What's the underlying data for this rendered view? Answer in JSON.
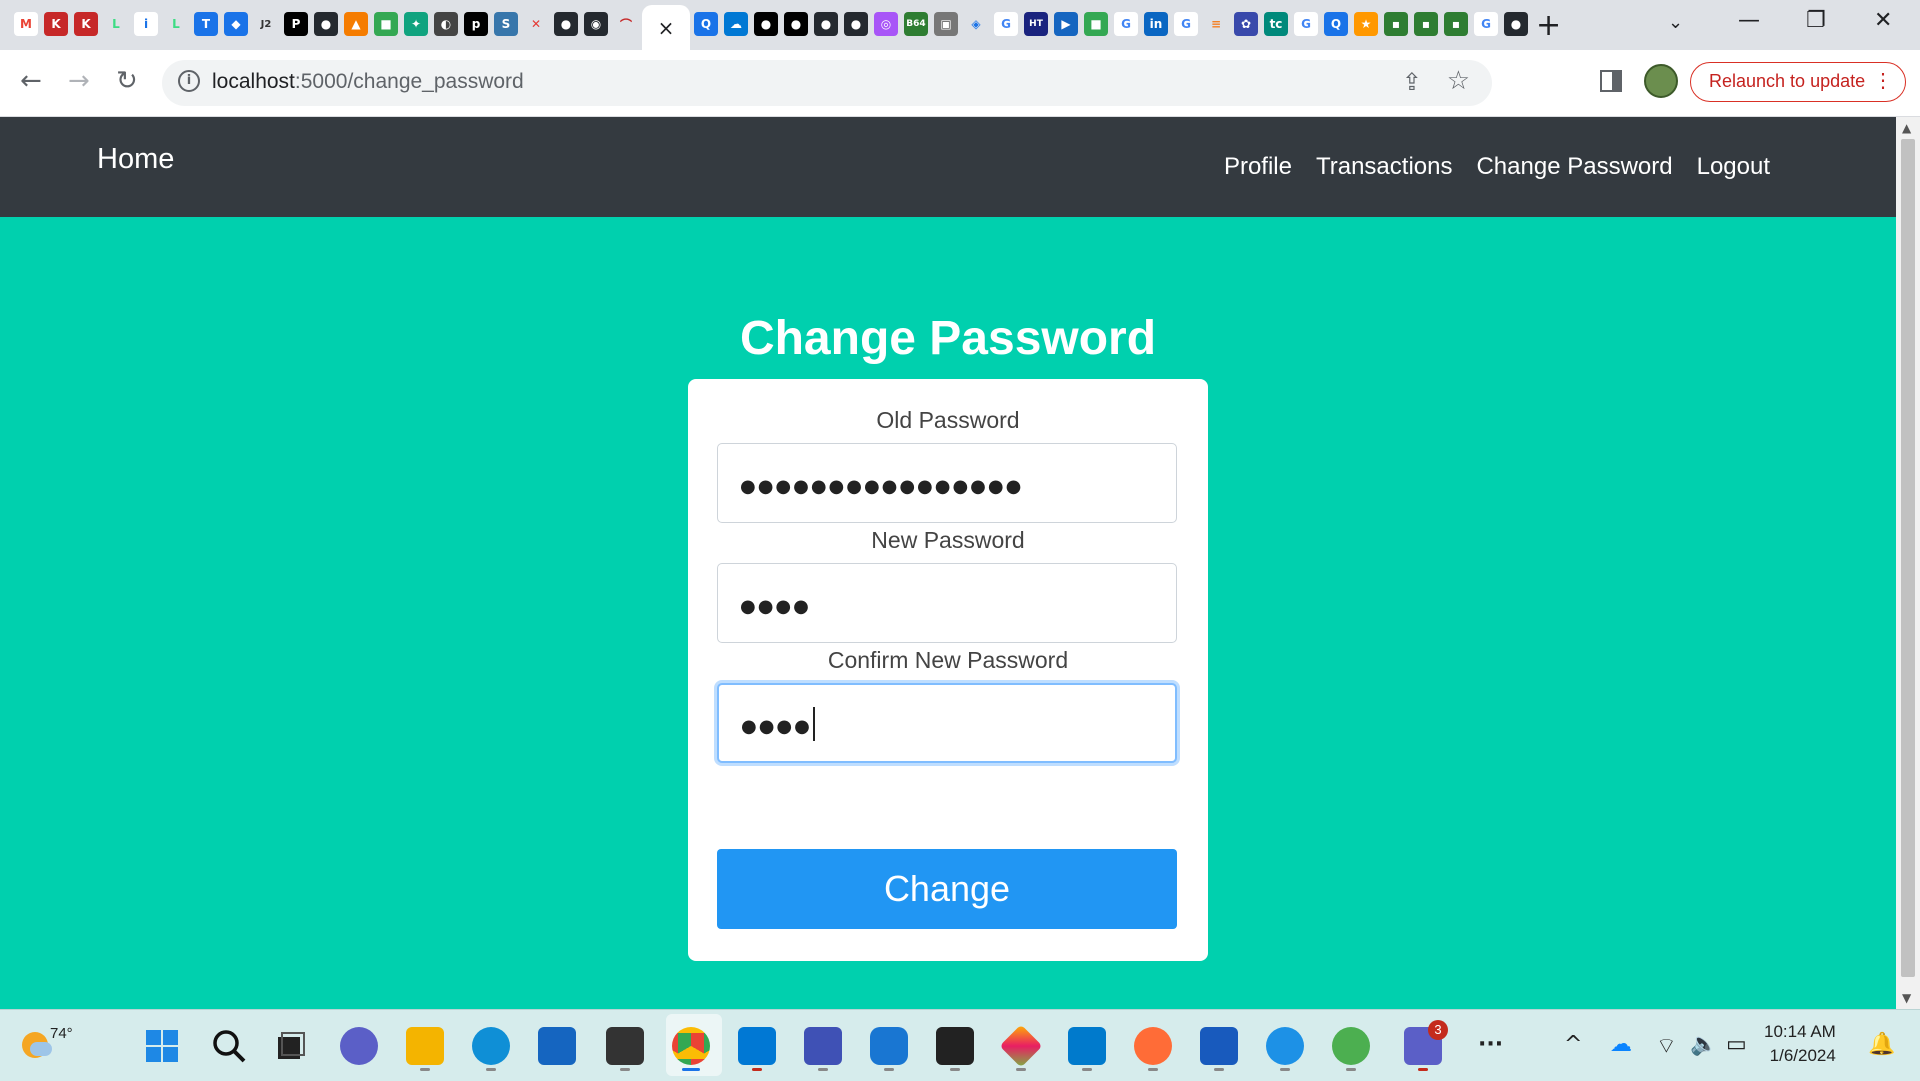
{
  "browser": {
    "url": "localhost:5000/change_password",
    "url_host": "localhost",
    "url_rest": ":5000/change_password",
    "relaunch_label": "Relaunch to update",
    "new_tab_symbol": "+",
    "close_tab_symbol": "×"
  },
  "navbar": {
    "brand": "Home",
    "links": [
      "Profile",
      "Transactions",
      "Change Password",
      "Logout"
    ]
  },
  "form": {
    "title": "Change Password",
    "fields": [
      {
        "label": "Old Password",
        "value": "●●●●●●●●●●●●●●●●"
      },
      {
        "label": "New Password",
        "value": "●●●●"
      },
      {
        "label": "Confirm New Password",
        "value": "●●●●"
      }
    ],
    "submit_label": "Change"
  },
  "taskbar": {
    "temperature": "74°",
    "teams_badge": "3",
    "time": "10:14 AM",
    "date": "1/6/2024",
    "colors": {
      "page_bg": "#00d0ae",
      "navbar_bg": "#343a40",
      "button_bg": "#2196f3"
    }
  }
}
